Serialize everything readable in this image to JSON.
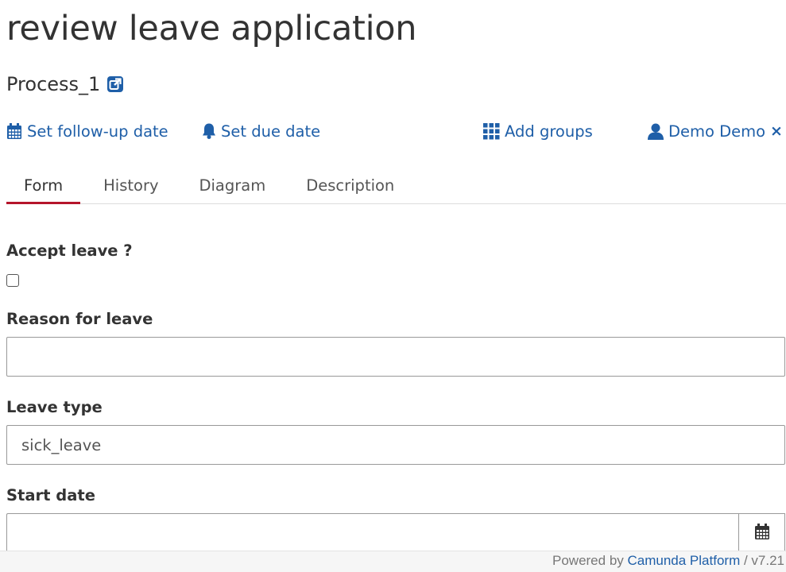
{
  "task": {
    "title": "review leave application",
    "process_name": "Process_1"
  },
  "actions": {
    "follow_up": "Set follow-up date",
    "due_date": "Set due date",
    "add_groups": "Add groups",
    "assignee": "Demo Demo",
    "remove_assignee": "×"
  },
  "tabs": [
    {
      "label": "Form",
      "active": true
    },
    {
      "label": "History",
      "active": false
    },
    {
      "label": "Diagram",
      "active": false
    },
    {
      "label": "Description",
      "active": false
    }
  ],
  "form": {
    "accept_label": "Accept leave ?",
    "accept_checked": false,
    "reason_label": "Reason for leave",
    "reason_value": "",
    "leave_type_label": "Leave type",
    "leave_type_value": "sick_leave",
    "start_date_label": "Start date",
    "start_date_value": ""
  },
  "footer": {
    "prefix": "Powered by ",
    "link": "Camunda Platform",
    "version": " / v7.21"
  },
  "colors": {
    "link": "#1f5fa8",
    "active_tab_underline": "#b5152b"
  },
  "icons": [
    "external-link-icon",
    "calendar-icon",
    "bell-icon",
    "grid-icon",
    "user-icon",
    "close-icon"
  ]
}
